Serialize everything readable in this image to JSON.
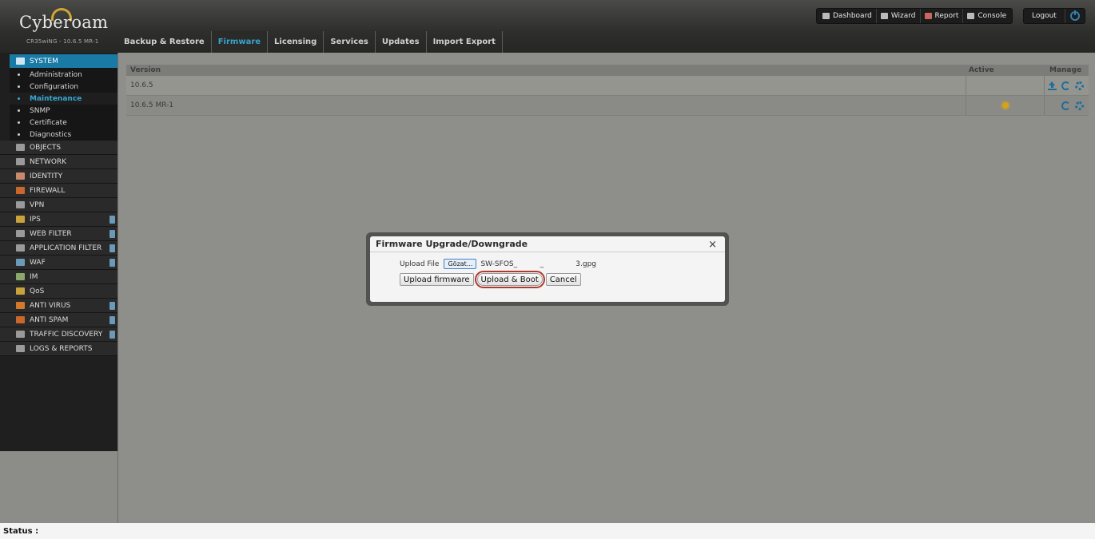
{
  "header": {
    "logo": "Cyberoam",
    "model": "CR35wiNG - 10.6.5 MR-1",
    "top_buttons": [
      "Dashboard",
      "Wizard",
      "Report",
      "Console"
    ],
    "logout": "Logout"
  },
  "tabs": [
    "Backup & Restore",
    "Firmware",
    "Licensing",
    "Services",
    "Updates",
    "Import Export"
  ],
  "sidebar": {
    "system": "SYSTEM",
    "system_items": [
      "Administration",
      "Configuration",
      "Maintenance",
      "SNMP",
      "Certificate",
      "Diagnostics"
    ],
    "sections": [
      "OBJECTS",
      "NETWORK",
      "IDENTITY",
      "FIREWALL",
      "VPN",
      "IPS",
      "WEB FILTER",
      "APPLICATION FILTER",
      "WAF",
      "IM",
      "QoS",
      "ANTI VIRUS",
      "ANTI SPAM",
      "TRAFFIC DISCOVERY",
      "LOGS & REPORTS"
    ]
  },
  "grid": {
    "headers": {
      "version": "Version",
      "active": "Active",
      "manage": "Manage"
    },
    "rows": [
      {
        "version": "10.6.5"
      },
      {
        "version": "10.6.5 MR-1"
      }
    ]
  },
  "dialog": {
    "title": "Firmware Upgrade/Downgrade",
    "close": "×",
    "upload_label": "Upload File",
    "browse": "Gözat...",
    "file_name": "SW-SFOS_          _              3.gpg",
    "upload_firmware": "Upload firmware",
    "upload_boot": "Upload & Boot",
    "cancel": "Cancel"
  },
  "status": "Status :",
  "colors": {
    "accent": "#1a7aa6",
    "highlight_ring": "#b03a2e",
    "active_tab": "#3aa4cc"
  }
}
